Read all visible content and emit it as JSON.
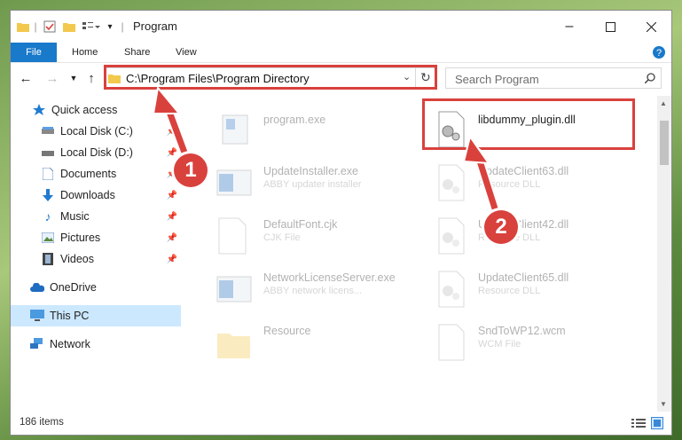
{
  "window": {
    "title": "Program"
  },
  "ribbon": {
    "tabs": [
      "File",
      "Home",
      "Share",
      "View"
    ]
  },
  "address": {
    "path": "C:\\Program Files\\Program Directory"
  },
  "search": {
    "placeholder": "Search Program"
  },
  "sidebar": {
    "items": [
      {
        "label": "Quick access"
      },
      {
        "label": "Local Disk (C:)"
      },
      {
        "label": "Local Disk (D:)"
      },
      {
        "label": "Documents"
      },
      {
        "label": "Downloads"
      },
      {
        "label": "Music"
      },
      {
        "label": "Pictures"
      },
      {
        "label": "Videos"
      },
      {
        "label": "OneDrive"
      },
      {
        "label": "This PC"
      },
      {
        "label": "Network"
      }
    ]
  },
  "files": [
    {
      "name": "program.exe",
      "desc": ""
    },
    {
      "name": "libdummy_plugin.dll",
      "desc": ""
    },
    {
      "name": "UpdateInstaller.exe",
      "desc": "ABBY updater installer"
    },
    {
      "name": "UpdateClient63.dll",
      "desc": "Resource DLL"
    },
    {
      "name": "DefaultFont.cjk",
      "desc": "CJK File"
    },
    {
      "name": "UpdateClient42.dll",
      "desc": "Resource DLL"
    },
    {
      "name": "NetworkLicenseServer.exe",
      "desc": "ABBY network licens..."
    },
    {
      "name": "UpdateClient65.dll",
      "desc": "Resource DLL"
    },
    {
      "name": "Resource",
      "desc": ""
    },
    {
      "name": "SndToWP12.wcm",
      "desc": "WCM File"
    }
  ],
  "status": {
    "count": "186 items"
  },
  "annotations": {
    "badge1": "1",
    "badge2": "2"
  },
  "colors": {
    "highlight": "#d9413d",
    "accent": "#1979ca",
    "selected": "#cce8ff"
  }
}
